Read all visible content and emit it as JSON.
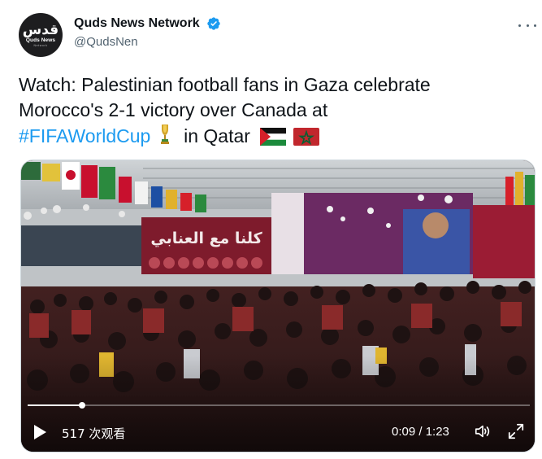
{
  "user": {
    "display_name": "Quds News Network",
    "handle": "@QudsNen",
    "avatar": {
      "arabic": "قدس",
      "latin": "Quds News",
      "small": "Network"
    }
  },
  "tweet": {
    "line1": "Watch: Palestinian football fans in Gaza celebrate",
    "line2": "Morocco's 2-1 victory over Canada at",
    "hashtag": "#FIFAWorldCup",
    "line3_tail": "in Qatar"
  },
  "video": {
    "views": "517 次观看",
    "time": "0:09 / 1:23",
    "progress_fraction": 0.108,
    "banner_text": "كلنا مع العنابي"
  },
  "icons": {
    "verified": "verified-badge-icon",
    "more": "more-options-icon",
    "play": "play-icon",
    "volume": "volume-icon",
    "fullscreen": "fullscreen-icon",
    "trophy": "trophy-emoji",
    "flag_palestine": "palestine-flag-emoji",
    "flag_morocco": "morocco-flag-emoji"
  },
  "colors": {
    "accent": "#1d9bf0",
    "text": "#0f1419",
    "muted": "#536471"
  }
}
